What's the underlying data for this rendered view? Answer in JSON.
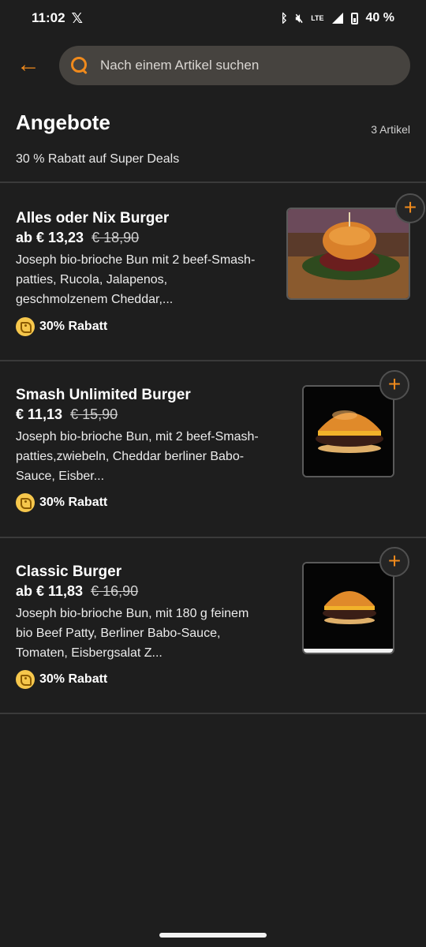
{
  "status_bar": {
    "time": "11:02",
    "network": "LTE",
    "battery": "40 %"
  },
  "search": {
    "placeholder": "Nach einem Artikel suchen"
  },
  "section": {
    "title": "Angebote",
    "count": "3 Artikel",
    "subtitle": "30 % Rabatt auf Super Deals"
  },
  "products": [
    {
      "name": "Alles oder Nix Burger",
      "price": "ab € 13,23",
      "old_price": "€ 18,90",
      "description": "Joseph bio-brioche Bun mit 2 beef-Smash-patties, Rucola, Jalapenos, geschmolzenem Cheddar,...",
      "discount": "30% Rabatt"
    },
    {
      "name": "Smash Unlimited Burger",
      "price": "€ 11,13",
      "old_price": "€ 15,90",
      "description": "Joseph bio-brioche Bun, mit 2 beef-Smash-patties,zwiebeln, Cheddar berliner Babo-Sauce, Eisber...",
      "discount": "30% Rabatt"
    },
    {
      "name": "Classic Burger",
      "price": "ab € 11,83",
      "old_price": "€ 16,90",
      "description": "Joseph bio-brioche Bun, mit 180 g feinem bio Beef Patty, Berliner Babo-Sauce, Tomaten, Eisbergsalat Z...",
      "discount": "30% Rabatt"
    }
  ],
  "colors": {
    "accent": "#f08a1c",
    "background": "#1e1e1e",
    "discount_badge": "#f6c74c"
  }
}
